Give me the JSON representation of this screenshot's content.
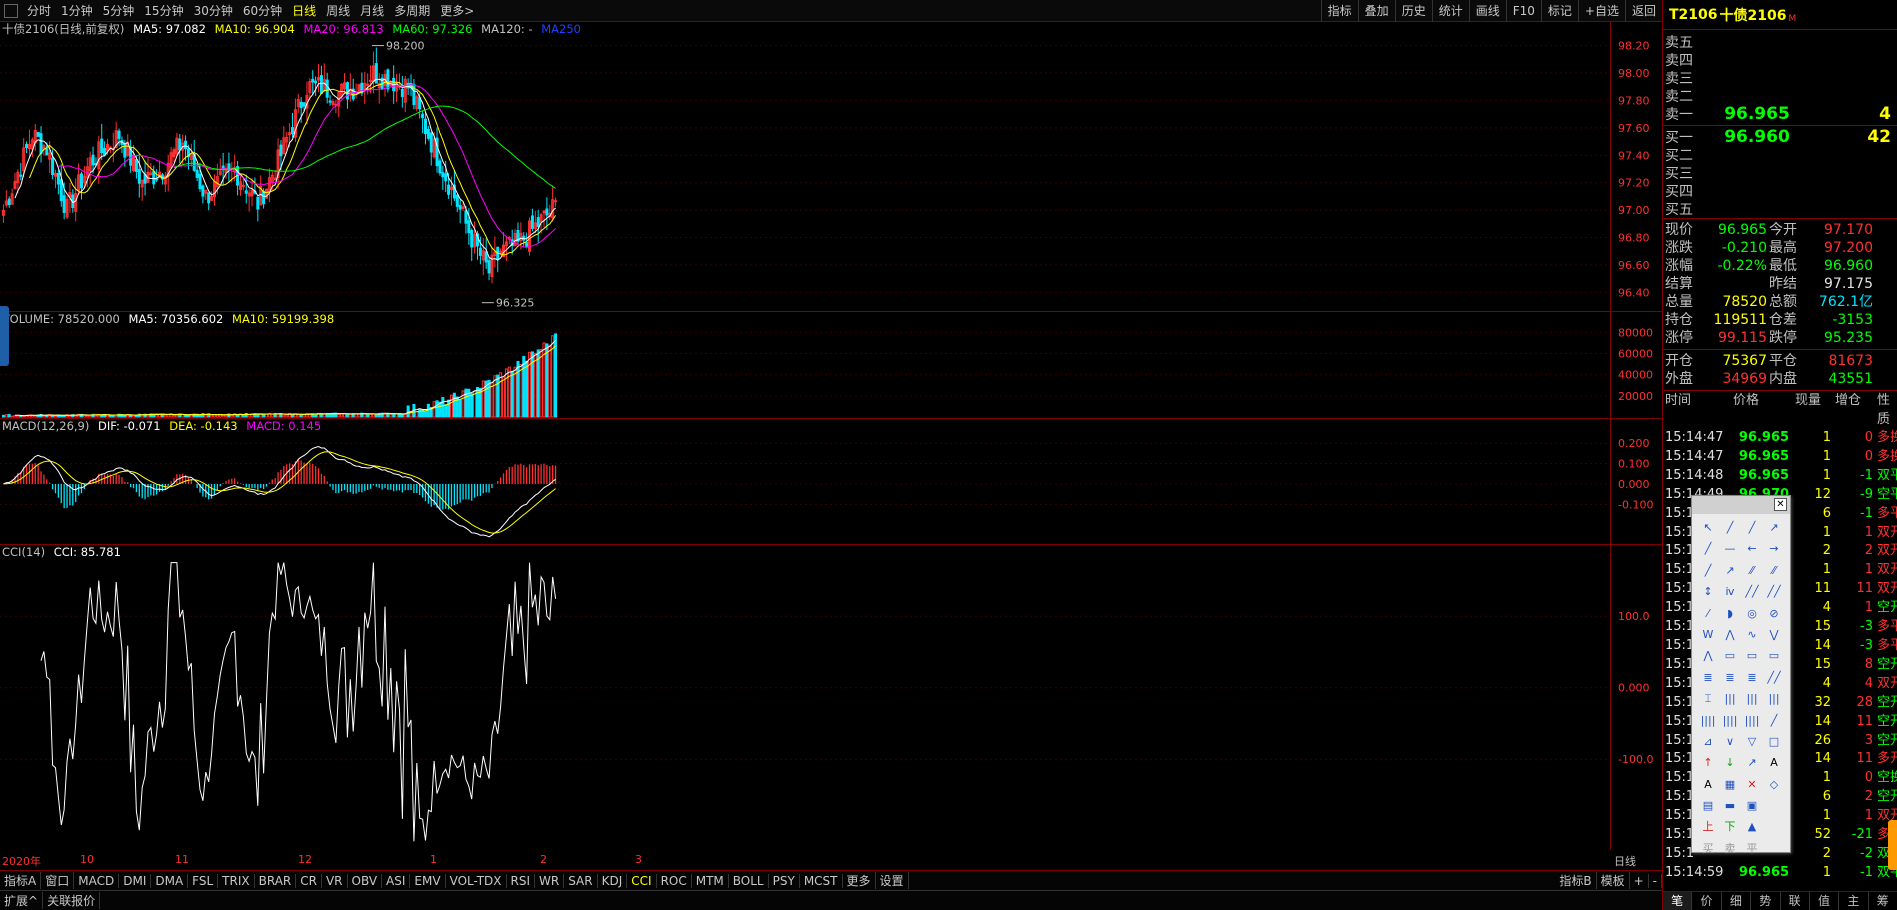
{
  "toolbar": {
    "periods": [
      "分时",
      "1分钟",
      "5分钟",
      "15分钟",
      "30分钟",
      "60分钟",
      "日线",
      "周线",
      "月线",
      "多周期",
      "更多>"
    ],
    "active_period": "日线",
    "right_items": [
      "指标",
      "叠加",
      "历史",
      "统计",
      "画线",
      "F10",
      "标记",
      "+自选",
      "返回"
    ]
  },
  "kline": {
    "title": "十债2106(日线,前复权)",
    "ma5": "MA5: 97.082",
    "ma10": "MA10: 96.904",
    "ma20": "MA20: 96.813",
    "ma60": "MA60: 97.326",
    "ma120": "MA120: -",
    "ma250": "MA250",
    "high_label": "98.200",
    "low_label": "96.325",
    "y_ticks": [
      "98.20",
      "98.00",
      "97.80",
      "97.60",
      "97.40",
      "97.20",
      "97.00",
      "96.80",
      "96.60",
      "96.40"
    ]
  },
  "volume": {
    "title": "VOLUME: 78520.000",
    "ma5": "MA5: 70356.602",
    "ma10": "MA10: 59199.398",
    "y_ticks": [
      "80000",
      "60000",
      "40000",
      "20000"
    ]
  },
  "macd": {
    "title": "MACD(12,26,9)",
    "dif": "DIF: -0.071",
    "dea": "DEA: -0.143",
    "macd": "MACD: 0.145",
    "y_ticks": [
      "0.200",
      "0.100",
      "0.000",
      "-0.100"
    ]
  },
  "cci": {
    "title": "CCI(14)",
    "value": "CCI: 85.781",
    "y_ticks": [
      "100.0",
      "0.000",
      "-100.0"
    ]
  },
  "xaxis": {
    "labels": [
      "2020年",
      "10",
      "11",
      "12",
      "1",
      "2",
      "3"
    ],
    "right_label": "日线"
  },
  "indicator_tabs": [
    "指标A",
    "窗口",
    "MACD",
    "DMI",
    "DMA",
    "FSL",
    "TRIX",
    "BRAR",
    "CR",
    "VR",
    "OBV",
    "ASI",
    "EMV",
    "VOL-TDX",
    "RSI",
    "WR",
    "SAR",
    "KDJ",
    "CCI",
    "ROC",
    "MTM",
    "BOLL",
    "PSY",
    "MCST",
    "更多",
    "设置"
  ],
  "indicator_right": [
    "指标B",
    "模板",
    "+",
    "-"
  ],
  "bottom_row2": [
    "扩展^",
    "关联报价"
  ],
  "quote": {
    "code": "T2106",
    "name": "十债2106",
    "flag": "M",
    "sell": [
      {
        "label": "卖五",
        "price": "",
        "vol": ""
      },
      {
        "label": "卖四",
        "price": "",
        "vol": ""
      },
      {
        "label": "卖三",
        "price": "",
        "vol": ""
      },
      {
        "label": "卖二",
        "price": "",
        "vol": ""
      },
      {
        "label": "卖一",
        "price": "96.965",
        "vol": "4"
      }
    ],
    "buy": [
      {
        "label": "买一",
        "price": "96.960",
        "vol": "42"
      },
      {
        "label": "买二",
        "price": "",
        "vol": ""
      },
      {
        "label": "买三",
        "price": "",
        "vol": ""
      },
      {
        "label": "买四",
        "price": "",
        "vol": ""
      },
      {
        "label": "买五",
        "price": "",
        "vol": ""
      }
    ],
    "stats": [
      [
        "现价",
        "96.965",
        "今开",
        "97.170"
      ],
      [
        "涨跌",
        "-0.210",
        "最高",
        "97.200"
      ],
      [
        "涨幅",
        "-0.22%",
        "最低",
        "96.960"
      ],
      [
        "结算",
        "",
        "昨结",
        "97.175"
      ],
      [
        "总量",
        "78520",
        "总额",
        "762.1亿"
      ],
      [
        "持仓",
        "119511",
        "仓差",
        "-3153"
      ],
      [
        "涨停",
        "99.115",
        "跌停",
        "95.235"
      ]
    ],
    "stats2": [
      [
        "开仓",
        "75367",
        "平仓",
        "81673"
      ],
      [
        "外盘",
        "34969",
        "内盘",
        "43551"
      ]
    ],
    "tick_header": [
      "时间",
      "价格",
      "现量",
      "增仓",
      "性质"
    ],
    "ticks": [
      [
        "15:14:47",
        "96.965",
        "1",
        "0",
        "多换"
      ],
      [
        "15:14:47",
        "96.965",
        "1",
        "0",
        "多换"
      ],
      [
        "15:14:48",
        "96.965",
        "1",
        "-1",
        "双平"
      ],
      [
        "15:14:49",
        "96.970",
        "12",
        "-9",
        "空平"
      ],
      [
        "15:1",
        "",
        "6",
        "-1",
        "多平"
      ],
      [
        "15:1",
        "",
        "1",
        "1",
        "双开"
      ],
      [
        "15:1",
        "",
        "2",
        "2",
        "双开"
      ],
      [
        "15:1",
        "",
        "1",
        "1",
        "双开"
      ],
      [
        "15:1",
        "",
        "11",
        "11",
        "双开"
      ],
      [
        "15:1",
        "",
        "4",
        "1",
        "空开"
      ],
      [
        "15:1",
        "",
        "15",
        "-3",
        "多平"
      ],
      [
        "15:1",
        "",
        "14",
        "-3",
        "多平"
      ],
      [
        "15:1",
        "",
        "15",
        "8",
        "空开"
      ],
      [
        "15:1",
        "",
        "4",
        "4",
        "双开"
      ],
      [
        "15:1",
        "",
        "32",
        "28",
        "空开"
      ],
      [
        "15:1",
        "",
        "14",
        "11",
        "空开"
      ],
      [
        "15:1",
        "",
        "26",
        "3",
        "空开"
      ],
      [
        "15:1",
        "",
        "14",
        "11",
        "多开"
      ],
      [
        "15:1",
        "",
        "1",
        "0",
        "空换"
      ],
      [
        "15:1",
        "",
        "6",
        "2",
        "空开"
      ],
      [
        "15:1",
        "",
        "1",
        "1",
        "双开"
      ],
      [
        "15:1",
        "",
        "52",
        "-21",
        "多平"
      ],
      [
        "15:1",
        "",
        "2",
        "-2",
        "双平"
      ],
      [
        "15:14:59",
        "96.965",
        "1",
        "-1",
        "双平"
      ]
    ],
    "tabs": [
      "笔",
      "价",
      "细",
      "势",
      "联",
      "值",
      "主",
      "筹"
    ]
  },
  "drawtools": {
    "bottom_labels": [
      "买",
      "卖",
      "平"
    ]
  },
  "colors": {
    "up": "#ff3030",
    "down": "#00e5ff",
    "ma5": "#ffffff",
    "ma10": "#ffff00",
    "ma20": "#ff00ff",
    "ma60": "#00ff00",
    "border": "#800000"
  }
}
